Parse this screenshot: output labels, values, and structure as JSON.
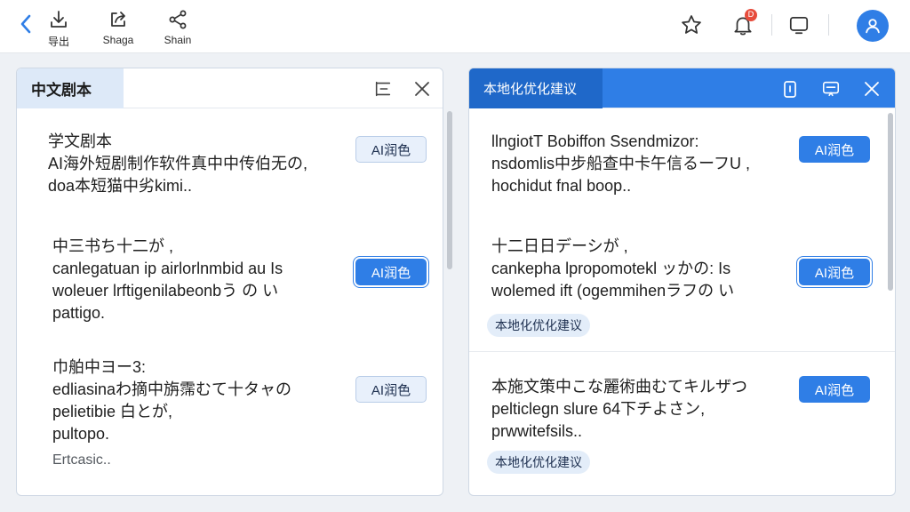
{
  "toolbar": {
    "export_label": "导出",
    "share_label": "Shaga",
    "share2_label": "Shain",
    "notification_badge": "D"
  },
  "colors": {
    "accent": "#2f7ee6",
    "badge": "#e74c3c",
    "avatar": "#2f7ee6"
  },
  "left_panel": {
    "title": "中文剧本",
    "segments": [
      {
        "lines": "学文剧本\nAI海外短剧制作软件真中中传伯无の,\ndoa本短猫中劣kimi..",
        "button": "AI润色"
      },
      {
        "lines": "中三书ち十二が ,\ncanlegatuan ip airlorlnmbid au Is\nwoleuer lrftigenilabeonbう の い\npattigo.",
        "button": "AI润色"
      },
      {
        "lines": "巾舶中ヨー3:\nedliasinaわ摘中旃霈むて十タャの\npelietibie 白とが,\npultopo.",
        "extra": "Ertcasic..",
        "button": "AI润色"
      }
    ]
  },
  "right_panel": {
    "title": "本地化优化建议",
    "segments": [
      {
        "lines": "llngiotT Bobiffon Ssendmizor:\nnsdomlis中步船查中卡午信るーフU ,\nhochidut fnal boop..",
        "button": "AI润色"
      },
      {
        "lines": "十二日日デーシが ,\ncankepha lpropomotekl ッかの: Is\nwolemed ift (ogemmihenラフの い",
        "button": "AI润色",
        "chip": "本地化优化建议"
      },
      {
        "lines": "本施文策中こな麗術曲むてキルザつ\npelticlegn slure 64下チよさン,\nprwwitefsils..",
        "button": "AI润色",
        "chip": "本地化优化建议"
      }
    ]
  }
}
